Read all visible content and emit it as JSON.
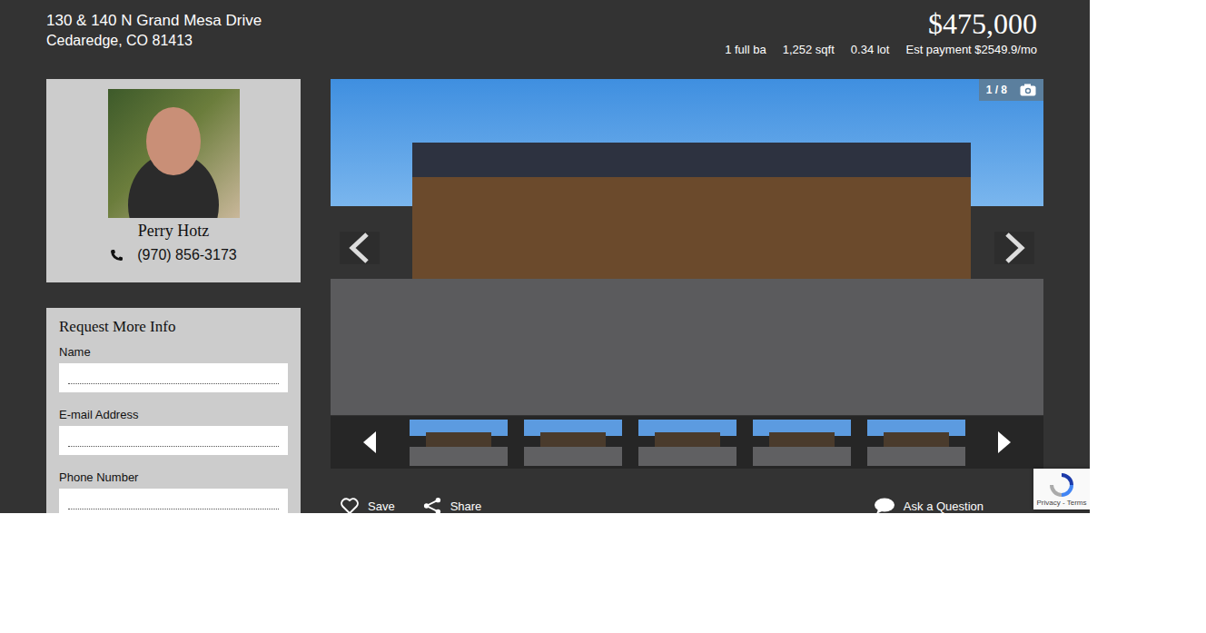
{
  "listing": {
    "address": "130 & 140 N Grand Mesa Drive",
    "city_line": "Cedaredge, CO 81413",
    "price": "$475,000",
    "stats": [
      "1 full ba",
      "1,252 sqft",
      "0.34 lot",
      "Est payment $2549.9/mo"
    ]
  },
  "agent": {
    "name": "Perry Hotz",
    "phone": "(970) 856-3173"
  },
  "form": {
    "title": "Request More Info",
    "fields": [
      {
        "label": "Name",
        "placeholder": ""
      },
      {
        "label": "E-mail Address",
        "placeholder": ""
      },
      {
        "label": "Phone Number",
        "placeholder": ""
      }
    ]
  },
  "gallery": {
    "counter": "1 / 8",
    "thumbnails": [
      {},
      {},
      {},
      {},
      {}
    ]
  },
  "actions": [
    {
      "label": "Save",
      "kind": "heart"
    },
    {
      "label": "Share",
      "kind": "share"
    },
    {
      "label": "Ask a Question",
      "kind": "chat"
    }
  ],
  "recaptcha": {
    "links": "Privacy - Terms"
  }
}
